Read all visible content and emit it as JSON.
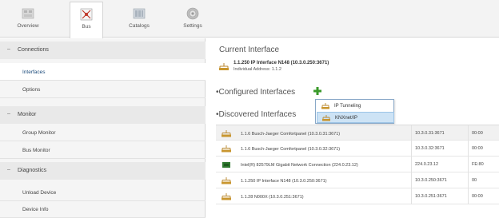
{
  "toolbar": {
    "buttons": [
      {
        "label": "Overview",
        "icon": "overview-icon"
      },
      {
        "label": "Bus",
        "icon": "bus-icon"
      },
      {
        "label": "Catalogs",
        "icon": "catalogs-icon"
      },
      {
        "label": "Settings",
        "icon": "settings-icon"
      }
    ]
  },
  "sidebar": {
    "sections": [
      {
        "label": "Connections",
        "items": [
          {
            "label": "Interfaces"
          },
          {
            "label": "Options"
          }
        ]
      },
      {
        "label": "Monitor",
        "items": [
          {
            "label": "Group Monitor"
          },
          {
            "label": "Bus Monitor"
          }
        ]
      },
      {
        "label": "Diagnostics",
        "items": [
          {
            "label": "Unload Device"
          },
          {
            "label": "Device Info"
          }
        ]
      }
    ]
  },
  "main": {
    "current_heading": "Current Interface",
    "current_name": "1.1.250 IP Interface N148 (10.3.0.250:3671)",
    "current_address": "Individual Address: 1.1.2",
    "configured_heading": "Configured Interfaces",
    "dropdown": [
      {
        "label": "IP Tunneling"
      },
      {
        "label": "KNXnet/IP"
      }
    ],
    "discovered_heading": "Discovered Interfaces",
    "discovered": [
      {
        "name": "1.1.6 Busch-Jaeger Comfortpanel (10.3.0.31:3671)",
        "address": "10.3.0.31:3671",
        "extra": "00:00"
      },
      {
        "name": "1.1.6 Busch-Jaeger Comfortpanel (10.3.0.32:3671)",
        "address": "10.3.0.32:3671",
        "extra": "00:00"
      },
      {
        "name": "Intel(R) 82579LM Gigabit Network Connection (224.0.23.12)",
        "address": "224.0.23.12",
        "extra": "FE:80"
      },
      {
        "name": "1.1.250 IP Interface N148 (10.3.0.250:3671)",
        "address": "10.3.0.250:3671",
        "extra": "00"
      },
      {
        "name": "1.1.28 N000X (10.3.0.251:3671)",
        "address": "10.3.0.251:3671",
        "extra": "00:00"
      }
    ]
  },
  "colors": {
    "accent": "#2b5a8c",
    "selection": "#cde3f5",
    "plus_green": "#3a9a2a"
  }
}
